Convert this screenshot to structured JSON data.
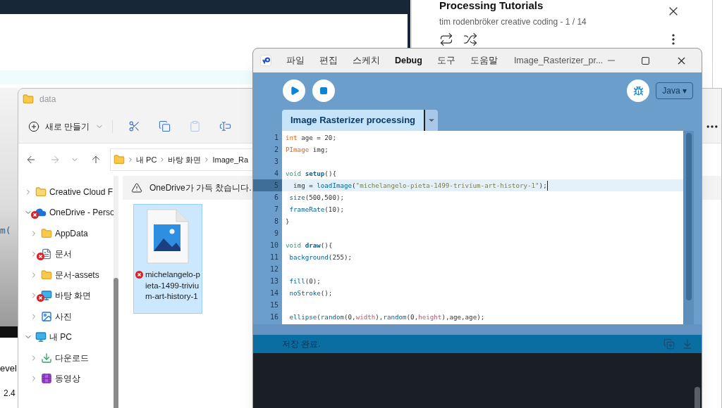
{
  "background": {
    "fragments": [
      "m(",
      "evel",
      "2.4"
    ]
  },
  "playlist": {
    "title": "Processing Tutorials",
    "subtitle": "tim rodenbröker creative coding - 1 / 14"
  },
  "explorer": {
    "title": "data",
    "new_button": "새로 만들기",
    "breadcrumb": [
      "내 PC",
      "바탕 화면",
      "Image_Ra"
    ],
    "tree": [
      {
        "label": "Creative Cloud F",
        "kind": "cloud-folder",
        "expanded": false,
        "error": false
      },
      {
        "label": "OneDrive - Perso",
        "kind": "onedrive",
        "expanded": true,
        "error": true,
        "children": [
          {
            "label": "AppData",
            "kind": "folder",
            "expanded": false,
            "error": false
          },
          {
            "label": "문서",
            "kind": "documents",
            "expanded": false,
            "error": true
          },
          {
            "label": "문서-assets",
            "kind": "folder",
            "expanded": false,
            "error": false
          },
          {
            "label": "바탕 화면",
            "kind": "desktop",
            "expanded": false,
            "error": true
          },
          {
            "label": "사진",
            "kind": "pictures",
            "expanded": false,
            "error": false
          }
        ]
      },
      {
        "label": "내 PC",
        "kind": "pc",
        "expanded": true,
        "error": false,
        "children": [
          {
            "label": "다운로드",
            "kind": "download",
            "expanded": false,
            "error": false
          },
          {
            "label": "동영상",
            "kind": "video",
            "expanded": false,
            "error": false
          }
        ]
      }
    ],
    "banner": "OneDrive가 가득 찼습니다.",
    "files": [
      {
        "name": "michelangelo-pieta-1499-trivium-art-history-1",
        "selected": true,
        "error": true
      }
    ]
  },
  "processing": {
    "menus": [
      {
        "label": "파일",
        "bold": false
      },
      {
        "label": "편집",
        "bold": false
      },
      {
        "label": "스케치",
        "bold": false
      },
      {
        "label": "Debug",
        "bold": true
      },
      {
        "label": "도구",
        "bold": false
      },
      {
        "label": "도움말",
        "bold": false
      }
    ],
    "title": "Image_Rasterizer_pr...",
    "mode": "Java ▾",
    "tabs": [
      {
        "label": "Image Rasterizer processing",
        "selected": true
      }
    ],
    "lines": [
      {
        "number": "1",
        "current": false,
        "tokens": [
          {
            "t": "int",
            "kind": "type"
          },
          {
            "t": " age = 20;",
            "kind": "plain"
          }
        ]
      },
      {
        "number": "2",
        "current": false,
        "tokens": [
          {
            "t": "PImage",
            "kind": "type"
          },
          {
            "t": " img;",
            "kind": "plain"
          }
        ]
      },
      {
        "number": "3",
        "current": false
      },
      {
        "number": "4",
        "current": false,
        "tokens": [
          {
            "t": "void",
            "kind": "keyword"
          },
          {
            "t": " setup",
            "kind": "entry"
          },
          {
            "t": "(){",
            "kind": "plain"
          }
        ]
      },
      {
        "number": "5",
        "current": true,
        "tokens": [
          {
            "t": "  img = ",
            "kind": "plain"
          },
          {
            "t": "loadImage",
            "kind": "function"
          },
          {
            "t": "(",
            "kind": "plain"
          },
          {
            "t": "\"michelangelo-pieta-1499-trivium-art-history-1\"",
            "kind": "string"
          },
          {
            "t": ");",
            "kind": "plain"
          }
        ]
      },
      {
        "number": "6",
        "current": false,
        "tokens": [
          {
            "t": " size",
            "kind": "function"
          },
          {
            "t": "(500,500);",
            "kind": "plain"
          }
        ]
      },
      {
        "number": "7",
        "current": false,
        "tokens": [
          {
            "t": " frameRate",
            "kind": "function"
          },
          {
            "t": "(10);",
            "kind": "plain"
          }
        ]
      },
      {
        "number": "8",
        "current": false,
        "tokens": [
          {
            "t": "}",
            "kind": "plain"
          }
        ]
      },
      {
        "number": "9",
        "current": false
      },
      {
        "number": "10",
        "current": false,
        "tokens": [
          {
            "t": "void",
            "kind": "keyword"
          },
          {
            "t": " draw",
            "kind": "entry"
          },
          {
            "t": "(){",
            "kind": "plain"
          }
        ]
      },
      {
        "number": "11",
        "current": false,
        "tokens": [
          {
            "t": " background",
            "kind": "function"
          },
          {
            "t": "(255);",
            "kind": "plain"
          }
        ]
      },
      {
        "number": "12",
        "current": false
      },
      {
        "number": "13",
        "current": false,
        "tokens": [
          {
            "t": " fill",
            "kind": "function"
          },
          {
            "t": "(0);",
            "kind": "plain"
          }
        ]
      },
      {
        "number": "14",
        "current": false,
        "tokens": [
          {
            "t": " noStroke",
            "kind": "function"
          },
          {
            "t": "();",
            "kind": "plain"
          }
        ]
      },
      {
        "number": "15",
        "current": false
      },
      {
        "number": "16",
        "current": false,
        "tokens": [
          {
            "t": " ellipse",
            "kind": "function"
          },
          {
            "t": "(",
            "kind": "plain"
          },
          {
            "t": "random",
            "kind": "function"
          },
          {
            "t": "(0,",
            "kind": "plain"
          },
          {
            "t": "width",
            "kind": "constant"
          },
          {
            "t": "),",
            "kind": "plain"
          },
          {
            "t": "random",
            "kind": "function"
          },
          {
            "t": "(0,",
            "kind": "plain"
          },
          {
            "t": "height",
            "kind": "constant"
          },
          {
            "t": "),age,age);",
            "kind": "plain"
          }
        ]
      }
    ],
    "status": "저장 완료."
  }
}
